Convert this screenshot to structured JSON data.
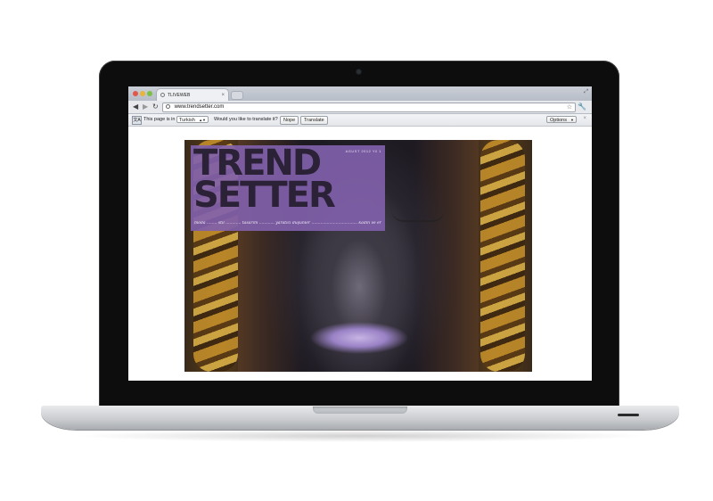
{
  "browser": {
    "tab_title": "TLIVEWEB",
    "url": "www.trendsetter.com"
  },
  "translate_bar": {
    "message": "This page is in",
    "language": "Turkish",
    "question": "Would you like to translate it?",
    "nope_label": "Nope",
    "translate_label": "Translate",
    "options_label": "Options"
  },
  "magazine": {
    "title_line1": "TREND",
    "title_line2": "SETTER",
    "issue_text": "AGUST 2012 Yil 1",
    "tagline": "moda ........ stil ............ tasarım ............ yaratıcı düşünler .................................... kadın ve erkek için"
  },
  "colors": {
    "accent_purple": "#8060aa",
    "lid": "#0d0d0e",
    "chrome": "#e7e9ed"
  }
}
